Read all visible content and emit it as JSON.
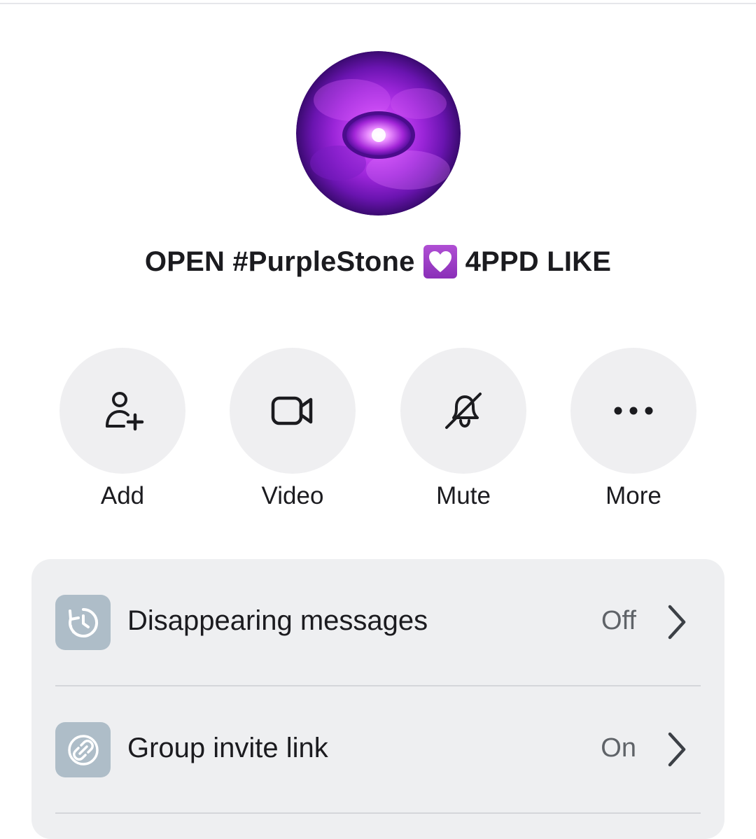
{
  "group": {
    "name_part1": "OPEN #PurpleStone",
    "name_part2": "4PPD LIKE",
    "emoji_icon": "heart-box-icon"
  },
  "actions": [
    {
      "label": "Add",
      "icon": "add-person-icon"
    },
    {
      "label": "Video",
      "icon": "video-camera-icon"
    },
    {
      "label": "Mute",
      "icon": "bell-off-icon"
    },
    {
      "label": "More",
      "icon": "more-dots-icon"
    }
  ],
  "settings": [
    {
      "label": "Disappearing messages",
      "value": "Off",
      "icon": "timer-history-icon"
    },
    {
      "label": "Group invite link",
      "value": "On",
      "icon": "link-icon"
    }
  ],
  "colors": {
    "accent_purple": "#a23bd6",
    "button_bg": "#efeff1",
    "card_bg": "#eeeff1",
    "icon_box": "#aebdc8"
  }
}
